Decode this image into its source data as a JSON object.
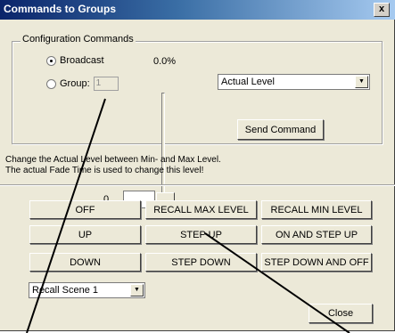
{
  "window": {
    "title": "Commands to Groups",
    "close_glyph": "x"
  },
  "config": {
    "legend": "Configuration Commands",
    "broadcast_label": "Broadcast",
    "group_label": "Group:",
    "group_value": "1",
    "percent": "0.0%",
    "level_value": "0",
    "command_select": "Actual Level",
    "send_label": "Send Command"
  },
  "info": {
    "line1": "Change the Actual Level between Min- and Max Level.",
    "line2": "The actual Fade Time is used to change this level!"
  },
  "buttons": {
    "off": "OFF",
    "recall_max": "RECALL MAX LEVEL",
    "recall_min": "RECALL MIN LEVEL",
    "up": "UP",
    "step_up": "STEP UP",
    "on_step_up": "ON AND STEP UP",
    "down": "DOWN",
    "step_down": "STEP DOWN",
    "step_down_off": "STEP DOWN AND OFF"
  },
  "scene_select": "Recall Scene 1",
  "close_label": "Close",
  "icons": {
    "combo_arrow": "caret-down-icon"
  }
}
